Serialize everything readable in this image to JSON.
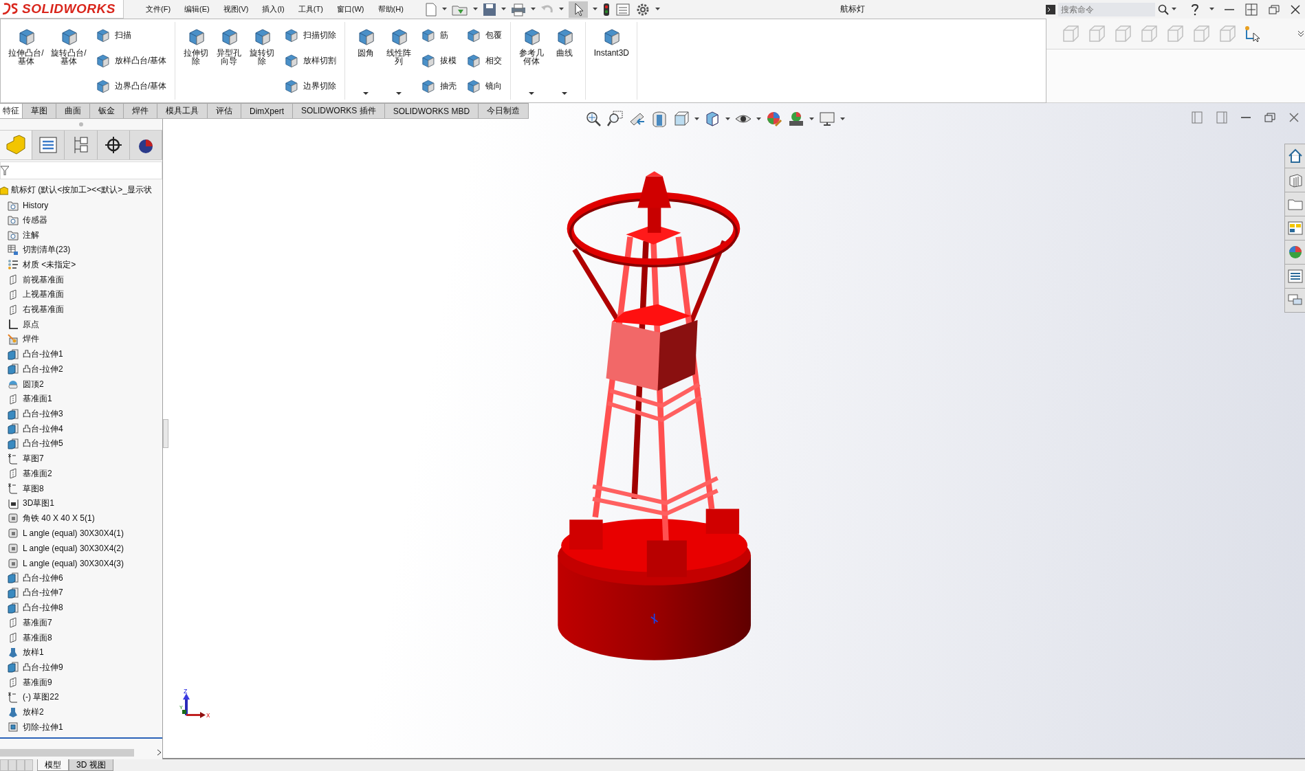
{
  "logo": {
    "text": "SOLIDWORKS"
  },
  "menus": [
    "文件(F)",
    "编辑(E)",
    "视图(V)",
    "插入(I)",
    "工具(T)",
    "窗口(W)",
    "帮助(H)"
  ],
  "title": "航标灯",
  "search": {
    "placeholder": "搜索命令"
  },
  "ribbon": {
    "groups": [
      {
        "items": [
          {
            "label": "拉伸凸台/基体",
            "kind": "large"
          },
          {
            "label": "旋转凸台/基体",
            "kind": "large"
          },
          {
            "label": "扫描",
            "kind": "small"
          },
          {
            "label": "放样凸台/基体",
            "kind": "small"
          },
          {
            "label": "边界凸台/基体",
            "kind": "small"
          }
        ]
      },
      {
        "items": [
          {
            "label": "拉伸切除",
            "kind": "large"
          },
          {
            "label": "异型孔向导",
            "kind": "large"
          },
          {
            "label": "旋转切除",
            "kind": "large"
          },
          {
            "label": "扫描切除",
            "kind": "small"
          },
          {
            "label": "放样切割",
            "kind": "small"
          },
          {
            "label": "边界切除",
            "kind": "small"
          }
        ]
      },
      {
        "items": [
          {
            "label": "圆角",
            "kind": "large",
            "dropdown": true
          },
          {
            "label": "线性阵列",
            "kind": "large",
            "dropdown": true
          },
          {
            "label": "筋",
            "kind": "small"
          },
          {
            "label": "拔模",
            "kind": "small"
          },
          {
            "label": "抽壳",
            "kind": "small"
          },
          {
            "label": "包覆",
            "kind": "small"
          },
          {
            "label": "相交",
            "kind": "small"
          },
          {
            "label": "镜向",
            "kind": "small"
          }
        ]
      },
      {
        "items": [
          {
            "label": "参考几何体",
            "kind": "large",
            "dropdown": true
          },
          {
            "label": "曲线",
            "kind": "large",
            "dropdown": true
          }
        ]
      },
      {
        "items": [
          {
            "label": "Instant3D",
            "kind": "large"
          }
        ]
      }
    ]
  },
  "command_tabs": [
    {
      "label": "特征",
      "selected": true
    },
    {
      "label": "草图",
      "selected": false
    },
    {
      "label": "曲面",
      "selected": false
    },
    {
      "label": "钣金",
      "selected": false
    },
    {
      "label": "焊件",
      "selected": false
    },
    {
      "label": "模具工具",
      "selected": false
    },
    {
      "label": "评估",
      "selected": false
    },
    {
      "label": "DimXpert",
      "selected": false
    },
    {
      "label": "SOLIDWORKS 插件",
      "selected": false
    },
    {
      "label": "SOLIDWORKS MBD",
      "selected": false
    },
    {
      "label": "今日制造",
      "selected": false
    }
  ],
  "feature_tree": {
    "root": "航标灯  (默认<按加工><<默认>_显示状",
    "items": [
      {
        "label": "History",
        "kind": "history"
      },
      {
        "label": "传感器",
        "kind": "sensor"
      },
      {
        "label": "注解",
        "kind": "annotation"
      },
      {
        "label": "切割清单(23)",
        "kind": "cutlist"
      },
      {
        "label": "材质 <未指定>",
        "kind": "material"
      },
      {
        "label": "前视基准面",
        "kind": "plane"
      },
      {
        "label": "上视基准面",
        "kind": "plane"
      },
      {
        "label": "右视基准面",
        "kind": "plane"
      },
      {
        "label": "原点",
        "kind": "origin"
      },
      {
        "label": "焊件",
        "kind": "weldment"
      },
      {
        "label": "凸台-拉伸1",
        "kind": "extrude"
      },
      {
        "label": "凸台-拉伸2",
        "kind": "extrude"
      },
      {
        "label": "圆顶2",
        "kind": "dome"
      },
      {
        "label": "基准面1",
        "kind": "plane"
      },
      {
        "label": "凸台-拉伸3",
        "kind": "extrude"
      },
      {
        "label": "凸台-拉伸4",
        "kind": "extrude"
      },
      {
        "label": "凸台-拉伸5",
        "kind": "extrude"
      },
      {
        "label": "草图7",
        "kind": "sketch"
      },
      {
        "label": "基准面2",
        "kind": "plane"
      },
      {
        "label": "草图8",
        "kind": "sketch"
      },
      {
        "label": "3D草图1",
        "kind": "sketch3d"
      },
      {
        "label": "角铁 40 X 40 X 5(1)",
        "kind": "structural"
      },
      {
        "label": "L angle (equal) 30X30X4(1)",
        "kind": "structural"
      },
      {
        "label": "L angle (equal) 30X30X4(2)",
        "kind": "structural"
      },
      {
        "label": "L angle (equal) 30X30X4(3)",
        "kind": "structural"
      },
      {
        "label": "凸台-拉伸6",
        "kind": "extrude"
      },
      {
        "label": "凸台-拉伸7",
        "kind": "extrude"
      },
      {
        "label": "凸台-拉伸8",
        "kind": "extrude"
      },
      {
        "label": "基准面7",
        "kind": "plane"
      },
      {
        "label": "基准面8",
        "kind": "plane"
      },
      {
        "label": "放样1",
        "kind": "loft"
      },
      {
        "label": "凸台-拉伸9",
        "kind": "extrude"
      },
      {
        "label": "基准面9",
        "kind": "plane"
      },
      {
        "label": "(-) 草图22",
        "kind": "sketch"
      },
      {
        "label": "放样2",
        "kind": "loft"
      },
      {
        "label": "切除-拉伸1",
        "kind": "cut"
      }
    ]
  },
  "model_tabs": [
    {
      "label": "模型",
      "selected": true
    },
    {
      "label": "3D 视图",
      "selected": false
    }
  ],
  "triad": {
    "x": "X",
    "y": "Y",
    "z": "Z"
  }
}
